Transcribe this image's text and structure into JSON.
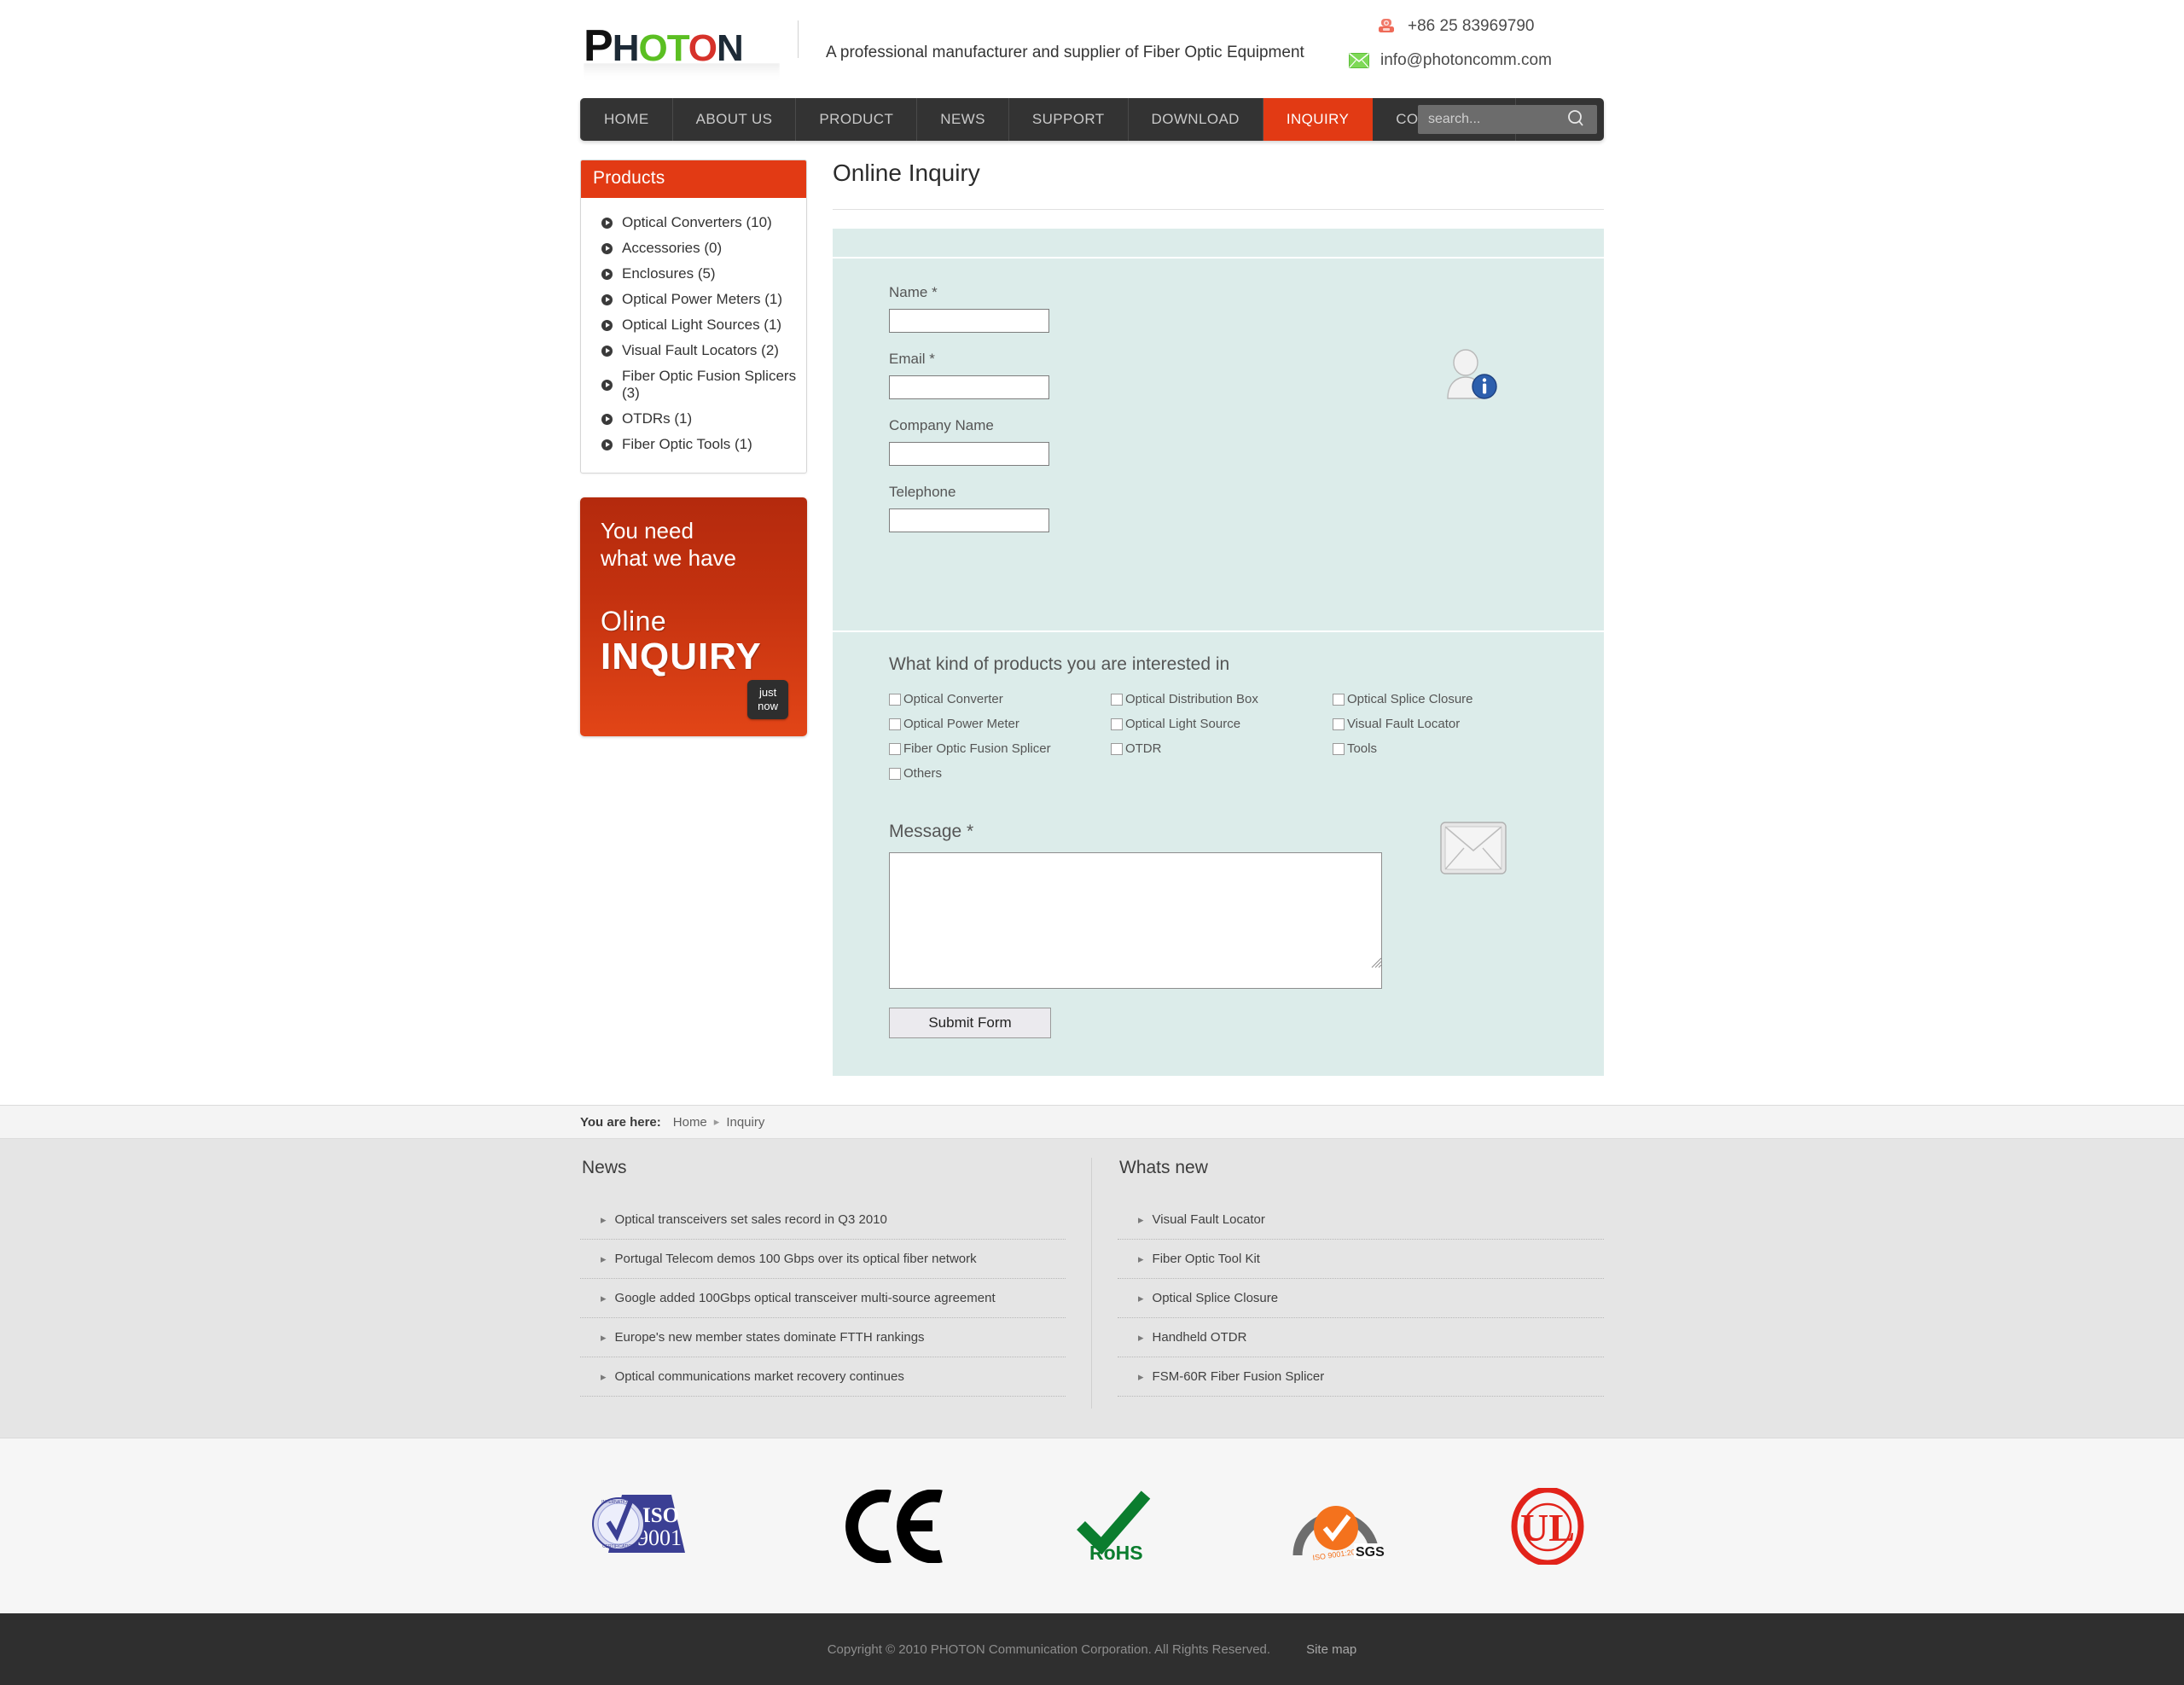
{
  "header": {
    "logo": {
      "part1": "P",
      "part2": "H",
      "part3": "OT",
      "part4": "O",
      "part5": "N",
      "alt": "PHOTON"
    },
    "tagline": "A professional manufacturer and supplier of Fiber Optic Equipment",
    "phone_icon": "telephone-icon",
    "phone": "+86 25 83969790",
    "mail_icon": "envelope-icon",
    "email": "info@photoncomm.com"
  },
  "nav": {
    "items": [
      {
        "label": "HOME",
        "active": false
      },
      {
        "label": "ABOUT US",
        "active": false
      },
      {
        "label": "PRODUCT",
        "active": false
      },
      {
        "label": "NEWS",
        "active": false
      },
      {
        "label": "SUPPORT",
        "active": false
      },
      {
        "label": "DOWNLOAD",
        "active": false
      },
      {
        "label": "INQUIRY",
        "active": true
      },
      {
        "label": "CONTACT US",
        "active": false
      }
    ],
    "search": {
      "placeholder": "search...",
      "value": "",
      "icon": "search-icon"
    }
  },
  "sidebar": {
    "products_title": "Products",
    "products": [
      {
        "label": "Optical Converters (10)"
      },
      {
        "label": "Accessories (0)"
      },
      {
        "label": "Enclosures (5)"
      },
      {
        "label": "Optical Power Meters (1)"
      },
      {
        "label": "Optical Light Sources (1)"
      },
      {
        "label": "Visual Fault Locators (2)"
      },
      {
        "label": "Fiber Optic Fusion Splicers (3)"
      },
      {
        "label": "OTDRs (1)"
      },
      {
        "label": "Fiber Optic Tools (1)"
      }
    ],
    "banner": {
      "line1": "You need",
      "line2": "what we have",
      "line3": "Oline",
      "line4": "INQUIRY",
      "button_l1": "just",
      "button_l2": "now",
      "color": "#c3310f"
    }
  },
  "main": {
    "title": "Online Inquiry",
    "form": {
      "name_label": "Name *",
      "name_value": "",
      "email_label": "Email *",
      "email_value": "",
      "company_label": "Company Name",
      "company_value": "",
      "telephone_label": "Telephone",
      "telephone_value": "",
      "person_icon": "user-info-icon",
      "envelope_icon": "envelope-icon",
      "interest_title": "What kind of products you are interested in",
      "interests": [
        {
          "label": "Optical Converter",
          "checked": false
        },
        {
          "label": "Optical Distribution Box",
          "checked": false
        },
        {
          "label": "Optical Splice Closure",
          "checked": false
        },
        {
          "label": "Optical Power Meter",
          "checked": false
        },
        {
          "label": "Optical Light Source",
          "checked": false
        },
        {
          "label": "Visual Fault Locator",
          "checked": false
        },
        {
          "label": "Fiber Optic Fusion Splicer",
          "checked": false
        },
        {
          "label": "OTDR",
          "checked": false
        },
        {
          "label": "Tools",
          "checked": false
        },
        {
          "label": "Others",
          "checked": false
        }
      ],
      "message_label": "Message *",
      "message_value": "",
      "submit_label": "Submit Form"
    },
    "panel_color": "#dcecea"
  },
  "breadcrumb": {
    "lead": "You are here:",
    "home": "Home",
    "separator": "▸",
    "current": "Inquiry"
  },
  "footer": {
    "news_title": "News",
    "news_items": [
      {
        "label": "Optical transceivers set sales record in Q3 2010"
      },
      {
        "label": "Portugal Telecom demos 100 Gbps over its optical fiber network"
      },
      {
        "label": "Google added 100Gbps optical transceiver multi-source agreement"
      },
      {
        "label": "Europe's new member states dominate FTTH rankings"
      },
      {
        "label": "Optical communications market recovery continues"
      }
    ],
    "whatsnew_title": "Whats new",
    "whatsnew_items": [
      {
        "label": "Visual Fault Locator"
      },
      {
        "label": "Fiber Optic Tool Kit"
      },
      {
        "label": "Optical Splice Closure"
      },
      {
        "label": "Handheld OTDR"
      },
      {
        "label": "FSM-60R Fiber Fusion Splicer"
      }
    ],
    "arrow": "▸",
    "certifications": [
      {
        "name": "iso-9001-logo",
        "label": "ISO 9001"
      },
      {
        "name": "ce-logo",
        "label": "CE"
      },
      {
        "name": "rohs-logo",
        "label": "RoHS"
      },
      {
        "name": "sgs-logo",
        "label": "SGS ISO 9001:2000"
      },
      {
        "name": "ul-logo",
        "label": "UL"
      }
    ],
    "copyright": "Copyright © 2010 PHOTON Communication Corporation. All Rights Reserved.",
    "sitemap": "Site map"
  }
}
